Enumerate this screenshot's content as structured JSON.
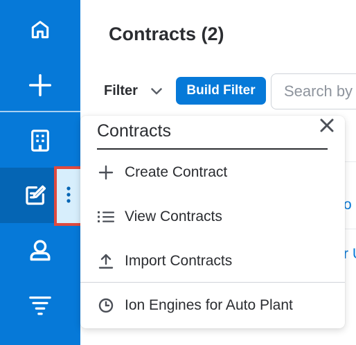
{
  "sidebar": {
    "items": [
      {
        "name": "home-icon"
      },
      {
        "name": "plus-icon"
      },
      {
        "name": "building-icon"
      },
      {
        "name": "edit-contract-icon"
      },
      {
        "name": "person-icon"
      },
      {
        "name": "filter-icon"
      }
    ],
    "active_index": 3,
    "actions_icon": "vertical-ellipsis-icon"
  },
  "header": {
    "title": "Contracts (2)"
  },
  "filters": {
    "filter_label": "Filter",
    "build_filter_label": "Build Filter",
    "search_placeholder": "Search by"
  },
  "list_preview": {
    "link_fragments": [
      "o",
      "r U"
    ]
  },
  "dropdown": {
    "title": "Contracts",
    "close_icon": "close-icon",
    "items": [
      {
        "label": "Create Contract",
        "icon": "plus-icon"
      },
      {
        "label": "View Contracts",
        "icon": "list-icon"
      },
      {
        "label": "Import Contracts",
        "icon": "upload-icon"
      }
    ],
    "recent_item": {
      "label": "Ion Engines for Auto Plant",
      "icon": "clock-icon"
    }
  },
  "colors": {
    "sidebar_bg": "#0679d8",
    "sidebar_active_bg": "#0565b4",
    "highlight_border": "#e04a3f",
    "highlight_bg": "#d7eefc",
    "text_primary": "#2b2d31",
    "accent": "#0679d8"
  }
}
